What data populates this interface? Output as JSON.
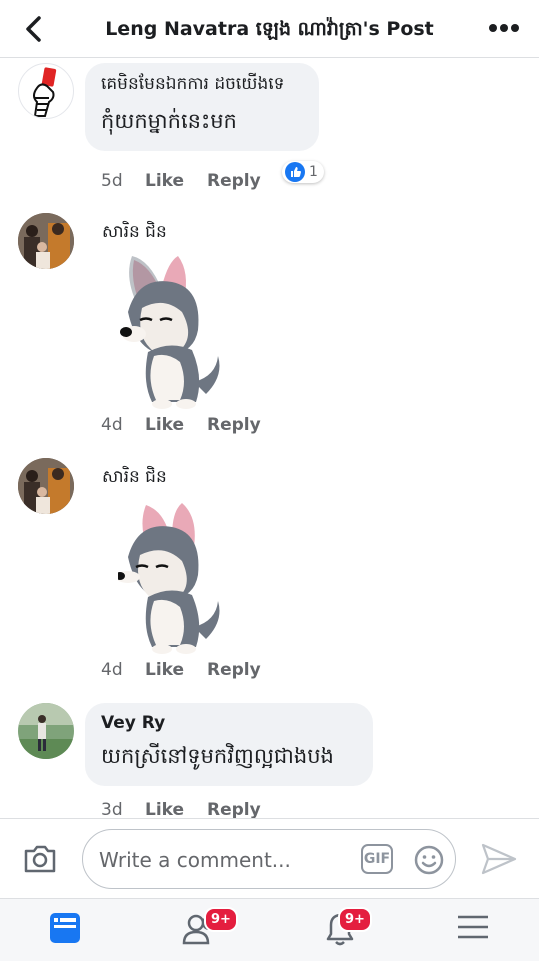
{
  "header": {
    "back_icon": "chevron-left-icon",
    "title": "Leng Navatra  ឡេង ណាវ៉ាត្រា's Post",
    "more_icon": "more-horizontal-icon"
  },
  "comments": [
    {
      "author": "គេមិនមែនឯកការ ដចយេីងទេ",
      "text": "កុំយកម្នាក់នេះមក",
      "time": "5d",
      "like": "Like",
      "reply": "Reply",
      "reaction_count": "1",
      "reaction_icon": "like-reaction-icon"
    },
    {
      "author": "សារិន ជិន",
      "sticker": "husky-sticker",
      "time": "4d",
      "like": "Like",
      "reply": "Reply"
    },
    {
      "author": "សារិន ជិន",
      "sticker": "husky-sticker",
      "time": "4d",
      "like": "Like",
      "reply": "Reply"
    },
    {
      "author": "Vey Ry",
      "text": "យកស្រីនៅទូមកវិញល្អជាងបង",
      "time": "3d",
      "like": "Like",
      "reply": "Reply"
    }
  ],
  "composer": {
    "placeholder": "Write a comment...",
    "gif_label": "GIF",
    "camera_icon": "camera-icon",
    "emoji_icon": "emoji-icon",
    "send_icon": "send-icon"
  },
  "tabbar": {
    "friends_badge": "9+",
    "notifications_badge": "9+",
    "icons": [
      "news-feed-icon",
      "friends-icon",
      "notifications-bell-icon",
      "menu-icon"
    ]
  },
  "colors": {
    "accent": "#1877f2",
    "badge": "#e41e3f",
    "bubble": "#f0f2f5",
    "secondary_text": "#65676b"
  }
}
